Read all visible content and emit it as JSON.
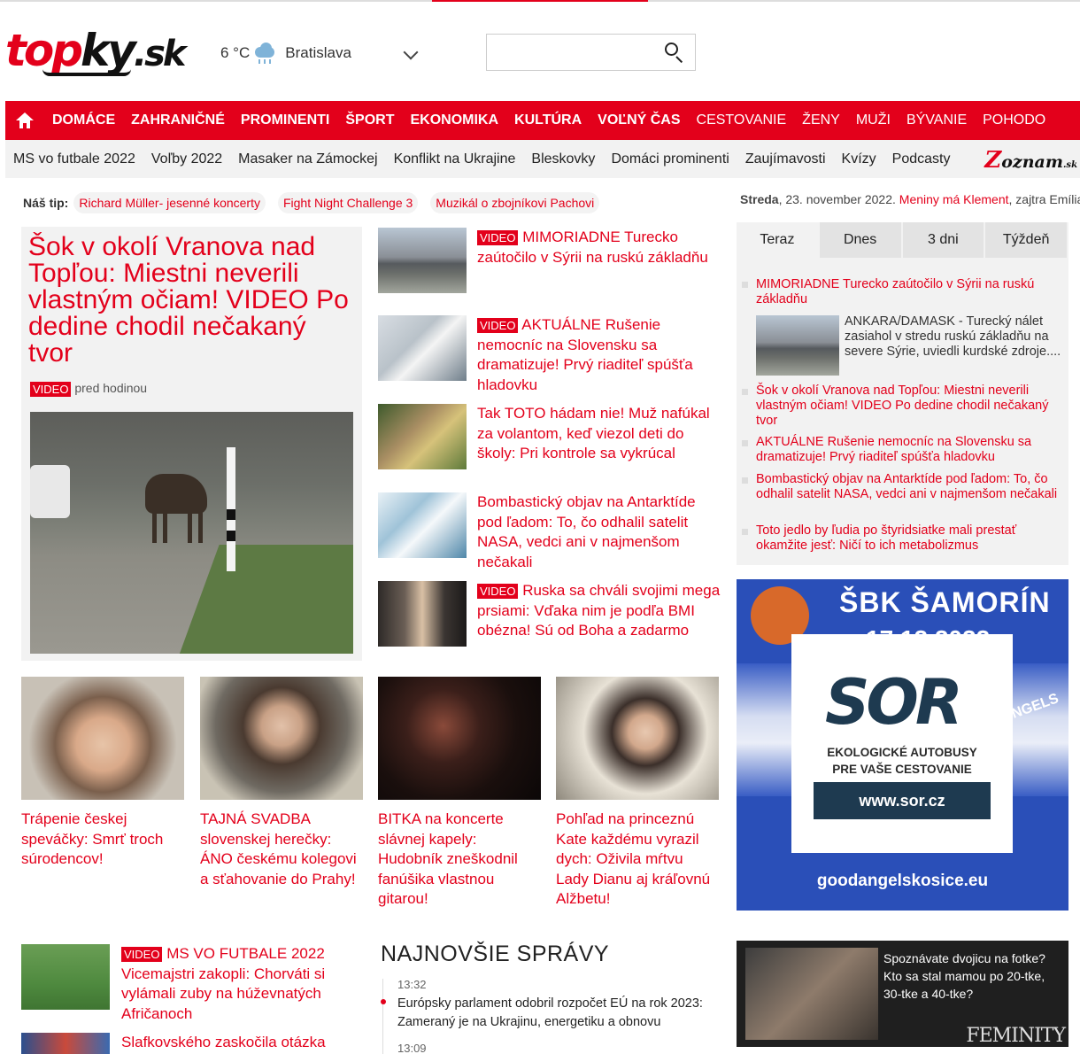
{
  "header": {
    "logo": {
      "part1": "top",
      "part2": "ky",
      "part3": ".sk"
    },
    "weather": {
      "temp": "6 °C",
      "city": "Bratislava",
      "icon": "cloud-rain-icon"
    },
    "search": {
      "placeholder": "",
      "value": ""
    }
  },
  "colors": {
    "accent": "#e3001b",
    "nav_bg": "#e3001b",
    "subnav_bg": "#f2f2f2"
  },
  "main_nav": [
    {
      "label": "DOMÁCE",
      "bold": true
    },
    {
      "label": "ZAHRANIČNÉ",
      "bold": true
    },
    {
      "label": "PROMINENTI",
      "bold": true
    },
    {
      "label": "ŠPORT",
      "bold": true
    },
    {
      "label": "EKONOMIKA",
      "bold": true
    },
    {
      "label": "KULTÚRA",
      "bold": true
    },
    {
      "label": "VOĽNÝ ČAS",
      "bold": true
    },
    {
      "label": "CESTOVANIE",
      "bold": false
    },
    {
      "label": "ŽENY",
      "bold": false
    },
    {
      "label": "MUŽI",
      "bold": false
    },
    {
      "label": "BÝVANIE",
      "bold": false
    },
    {
      "label": "POHODO",
      "bold": false
    }
  ],
  "sub_nav": [
    "MS vo futbale 2022",
    "Voľby 2022",
    "Masaker na Zámockej",
    "Konflikt na Ukrajine",
    "Bleskovky",
    "Domáci prominenti",
    "Zaujímavosti",
    "Kvízy",
    "Podcasty"
  ],
  "zoznam": {
    "z": "Z",
    "rest": "oznam",
    "sk": ".sk"
  },
  "tips": {
    "label": "Náš tip:",
    "items": [
      "Richard Müller- jesenné koncerty",
      "Fight Night Challenge 3",
      "Muzikál o zbojníkovi Pachovi"
    ]
  },
  "dateline": {
    "day": "Streda",
    "date": ", 23. november 2022.",
    "names_link": "Meniny má Klement",
    "tomorrow": ", zajtra Emília."
  },
  "lead": {
    "title": "Šok v okolí Vranova nad Topľou: Miestni neverili vlastným očiam! VIDEO Po dedine chodil nečakaný tvor",
    "badge": "VIDEO",
    "time": "pred hodinou"
  },
  "middle": [
    {
      "badge": "VIDEO",
      "title": "MIMORIADNE Turecko zaútočilo v Sýrii na ruskú základňu"
    },
    {
      "badge": "VIDEO",
      "title": "AKTUÁLNE Rušenie nemocníc na Slovensku sa dramatizuje! Prvý riaditeľ spúšťa hladovku"
    },
    {
      "badge": "",
      "title": "Tak TOTO hádam nie! Muž nafúkal za volantom, keď viezol deti do školy: Pri kontrole sa vykrúcal"
    },
    {
      "badge": "",
      "title": "Bombastický objav na Antarktíde pod ľadom: To, čo odhalil satelit NASA, vedci ani v najmenšom nečakali"
    },
    {
      "badge": "VIDEO",
      "title": "Ruska sa chváli svojimi mega prsiami: Vďaka nim je podľa BMI obézna! Sú od Boha a zadarmo"
    }
  ],
  "tabs": [
    "Teraz",
    "Dnes",
    "3 dni",
    "Týždeň"
  ],
  "right_list": [
    "MIMORIADNE Turecko zaútočilo v Sýrii na ruskú základňu",
    "Šok v okolí Vranova nad Topľou: Miestni neverili vlastným očiam! VIDEO Po dedine chodil nečakaný tvor",
    "AKTUÁLNE Rušenie nemocníc na Slovensku sa dramatizuje! Prvý riaditeľ spúšťa hladovku",
    "Bombastický objav na Antarktíde pod ľadom: To, čo odhalil satelit NASA, vedci ani v najmenšom nečakali",
    "Toto jedlo by ľudia po štyridsiatke mali prestať okamžite jesť: Ničí to ich metabolizmus"
  ],
  "right_desc": "ANKARA/DAMASK - Turecký nálet zasiahol v stredu ruskú základňu na severe Sýrie, uviedli kurdské zdroje....",
  "ad": {
    "title": "ŠBK ŠAMORÍN",
    "date": "17.12.2022",
    "logo": "SOR",
    "tagline1": "EKOLOGICKÉ AUTOBUSY",
    "tagline2": "PRE VAŠE CESTOVANIE",
    "url": "www.sor.cz",
    "angels": "NGELS",
    "footer": "goodangelskosice.eu"
  },
  "grid": [
    {
      "title": "Trápenie českej speváčky: Smrť troch súrodencov!"
    },
    {
      "title": "TAJNÁ SVADBA slovenskej herečky: ÁNO českému kolegovi a sťahovanie do Prahy!"
    },
    {
      "title": "BITKA na koncerte slávnej kapely: Hudobník zneškodnil fanúšika vlastnou gitarou!"
    },
    {
      "title": "Pohľad na princeznú Kate každému vyrazil dych: Oživila mŕtvu Lady Dianu aj kráľovnú Alžbetu!"
    }
  ],
  "bottom_left": [
    {
      "badge": "VIDEO",
      "title": "MS VO FUTBALE 2022 Vicemajstri zakopli: Chorváti si vylámali zuby na húževnatých Afričanoch"
    },
    {
      "badge": "",
      "title": "Slafkovského zaskočila otázka"
    }
  ],
  "news": {
    "title": "NAJNOVŠIE SPRÁVY",
    "items": [
      {
        "time": "13:32",
        "text": "Európsky parlament odobril rozpočet EÚ na rok 2023: Zameraný je na Ukrajinu, energetiku a obnovu"
      },
      {
        "time": "13:09",
        "text": ""
      }
    ]
  },
  "feminity": {
    "text": "Spoznávate dvojicu na fotke? Kto sa stal mamou po 20-tke, 30-tke a 40-tke?",
    "logo": "FEMINITY"
  }
}
